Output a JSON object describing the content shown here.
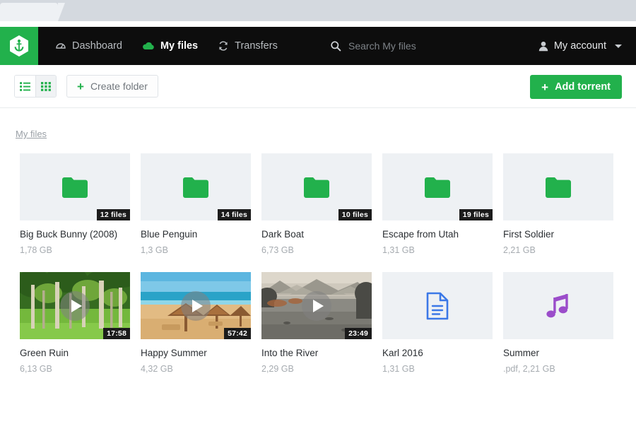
{
  "browser": {
    "tab_label": ""
  },
  "navbar": {
    "logo_icon": "anchor-hexagon-logo",
    "links": [
      {
        "label": "Dashboard",
        "icon": "dashboard-icon",
        "active": false
      },
      {
        "label": "My files",
        "icon": "cloud-icon",
        "active": true
      },
      {
        "label": "Transfers",
        "icon": "refresh-icon",
        "active": false
      }
    ],
    "search": {
      "placeholder": "Search My files",
      "icon": "search-icon"
    },
    "account": {
      "label": "My account",
      "icon": "user-icon",
      "caret": "chevron-down-icon"
    }
  },
  "toolbar": {
    "list_view_icon": "list-view-icon",
    "grid_view_icon": "grid-view-icon",
    "active_view": "grid",
    "create_folder_label": "Create folder",
    "create_folder_icon": "plus-icon",
    "add_torrent_label": "Add torrent",
    "add_torrent_icon": "plus-icon"
  },
  "breadcrumb": {
    "label": "My files"
  },
  "colors": {
    "brand_green": "#22b14c",
    "navbar_black": "#0d0d0d",
    "thumb_bg": "#eef1f4",
    "doc_blue": "#3b78e7",
    "music_purple": "#9b4dca"
  },
  "files": [
    {
      "name": "Big Buck Bunny (2008)",
      "meta": "1,78 GB",
      "type": "folder",
      "badge": "12 files",
      "icon": "folder-icon"
    },
    {
      "name": "Blue Penguin",
      "meta": "1,3 GB",
      "type": "folder",
      "badge": "14 files",
      "icon": "folder-icon"
    },
    {
      "name": "Dark Boat",
      "meta": "6,73 GB",
      "type": "folder",
      "badge": "10 files",
      "icon": "folder-icon"
    },
    {
      "name": "Escape from Utah",
      "meta": "1,31 GB",
      "type": "folder",
      "badge": "19 files",
      "icon": "folder-icon"
    },
    {
      "name": "First Soldier",
      "meta": "2,21 GB",
      "type": "folder",
      "badge": "",
      "icon": "folder-icon"
    },
    {
      "name": "Green Ruin",
      "meta": "6,13 GB",
      "type": "video",
      "badge": "17:58",
      "icon": "play-icon",
      "thumb": "forest-trees-photo"
    },
    {
      "name": "Happy Summer",
      "meta": "4,32 GB",
      "type": "video",
      "badge": "57:42",
      "icon": "play-icon",
      "thumb": "beach-umbrellas-photo"
    },
    {
      "name": "Into the River",
      "meta": "2,29 GB",
      "type": "video",
      "badge": "23:49",
      "icon": "play-icon",
      "thumb": "misty-river-photo"
    },
    {
      "name": "Karl 2016",
      "meta": "1,31 GB",
      "type": "document",
      "badge": "",
      "icon": "document-icon"
    },
    {
      "name": "Summer",
      "meta": ".pdf, 2,21 GB",
      "type": "audio",
      "badge": "",
      "icon": "music-note-icon"
    }
  ]
}
